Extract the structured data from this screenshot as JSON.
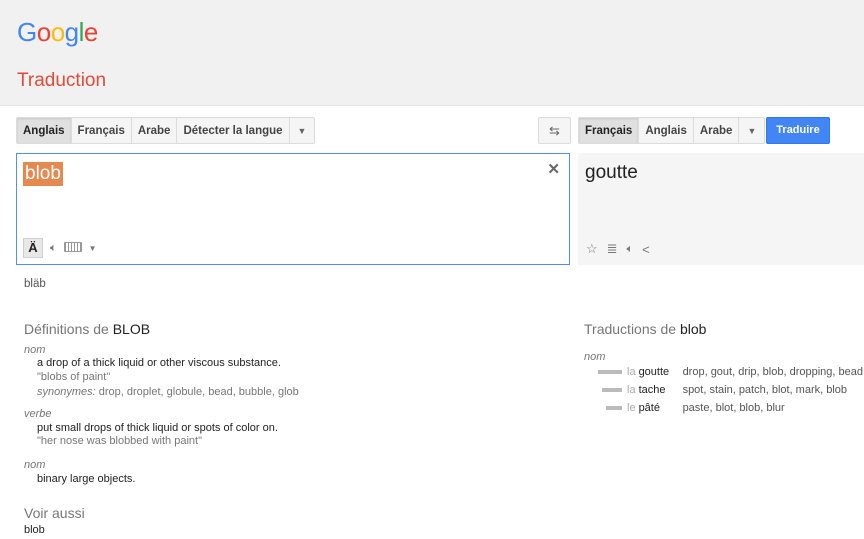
{
  "header": {
    "logo_letters": [
      {
        "ch": "G",
        "color": "#4285f4"
      },
      {
        "ch": "o",
        "color": "#ea4335"
      },
      {
        "ch": "o",
        "color": "#fbbc05"
      },
      {
        "ch": "g",
        "color": "#4285f4"
      },
      {
        "ch": "l",
        "color": "#34a853"
      },
      {
        "ch": "e",
        "color": "#ea4335"
      }
    ],
    "title": "Traduction"
  },
  "source_langs": [
    "Anglais",
    "Français",
    "Arabe",
    "Détecter la langue"
  ],
  "target_langs": [
    "Français",
    "Anglais",
    "Arabe"
  ],
  "translate_label": "Traduire",
  "source": {
    "text": "blob",
    "transliteration": "bläb"
  },
  "target": {
    "text": "goutte"
  },
  "definitions": {
    "heading_prefix": "Définitions de ",
    "heading_word": "BLOB",
    "entries": [
      {
        "pos": "nom",
        "def": "a drop of a thick liquid or other viscous substance.",
        "example": "\"blobs of paint\"",
        "syn_label": "synonymes:",
        "syn": " drop, droplet, globule, bead, bubble, glob"
      },
      {
        "pos": "verbe",
        "def": "put small drops of thick liquid or spots of color on.",
        "example": "\"her nose was blobbed with paint\""
      },
      {
        "pos": "nom",
        "def": "binary large objects."
      }
    ]
  },
  "translations": {
    "heading_prefix": "Traductions de ",
    "heading_word": "blob",
    "pos": "nom",
    "rows": [
      {
        "article": "la",
        "word": "goutte",
        "reverse": "drop, gout, drip, blob, dropping, bead",
        "freq": 1.0
      },
      {
        "article": "la",
        "word": "tache",
        "reverse": "spot, stain, patch, blot, mark, blob",
        "freq": 0.85
      },
      {
        "article": "le",
        "word": "pâté",
        "reverse": "paste, blot, blob, blur",
        "freq": 0.65
      }
    ]
  },
  "see_also": {
    "heading": "Voir aussi",
    "items": [
      "blob"
    ]
  },
  "colors": {
    "accent_red": "#dd4b39",
    "button_blue": "#4285f4",
    "highlight": "#e4894f"
  }
}
